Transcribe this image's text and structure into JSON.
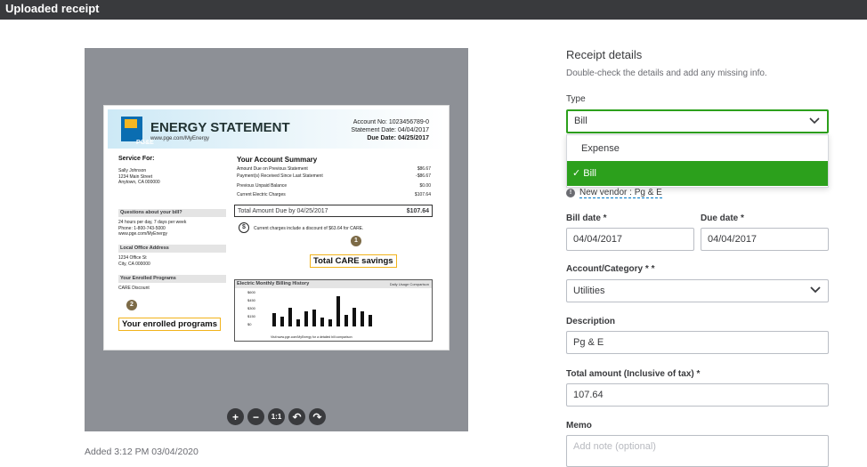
{
  "header": {
    "title": "Uploaded receipt"
  },
  "receipt_image": {
    "title": "ENERGY STATEMENT",
    "url": "www.pge.com/MyEnergy",
    "logo_text": "PG&E",
    "account_no_label": "Account No:",
    "account_no": "1023456789-0",
    "statement_date_label": "Statement Date:",
    "statement_date": "04/04/2017",
    "due_date_label": "Due Date:",
    "due_date": "04/25/2017",
    "service_for": "Service For:",
    "customer_name": "Sally Johnson",
    "customer_street": "1234 Main Street",
    "customer_city": "Anytown, CA 000000",
    "summary_title": "Your Account Summary",
    "summary_rows": [
      {
        "label": "Amount Due on Previous Statement",
        "value": "$86.67"
      },
      {
        "label": "Payment(s) Received Since Last Statement",
        "value": "-$86.67"
      },
      {
        "label": "Previous Unpaid Balance",
        "value": "$0.00"
      },
      {
        "label": "Current Electric Charges",
        "value": "$107.64"
      }
    ],
    "total_label": "Total Amount Due by 04/25/2017",
    "total_value": "$107.64",
    "questions_title": "Questions about your bill?",
    "questions_lines": [
      "24 hours per day, 7 days per week",
      "Phone: 1-800-743-5000",
      "www.pge.com/MyEnergy"
    ],
    "office_title": "Local Office Address",
    "office_lines": [
      "1234 Office St",
      "City, CA 000000"
    ],
    "programs_title": "Your Enrolled Programs",
    "programs_line": "CARE Discount",
    "discount_note": "Current charges include a discount of $63.64 for CARE.",
    "callout_1_num": "1",
    "callout_1": "Total CARE savings",
    "callout_2_num": "2",
    "callout_2": "Your enrolled programs",
    "chart_title": "Electric Monthly Billing History",
    "chart_side": "Daily Usage Comparison",
    "chart_yticks": [
      "$600",
      "$450",
      "$300",
      "$150",
      "$0"
    ],
    "chart_footer": "Visit www.pge.com/MyEnergy for a detailed bill comparison",
    "chart_bars": [
      0.4,
      0.3,
      0.55,
      0.2,
      0.45,
      0.5,
      0.25,
      0.2,
      0.9,
      0.35,
      0.55,
      0.45,
      0.35
    ]
  },
  "toolbar": {
    "zoom_in": "+",
    "zoom_out": "−",
    "actual": "1:1",
    "rotate_left": "↶",
    "rotate_right": "↷"
  },
  "added": "Added 3:12 PM 03/04/2020",
  "details": {
    "title": "Receipt details",
    "subtitle": "Double-check the details and add any missing info.",
    "type_label": "Type",
    "type_value": "Bill",
    "type_options": [
      "Expense",
      "✓ Bill"
    ],
    "vendor": "New vendor : Pg & E",
    "bill_date_label": "Bill date *",
    "bill_date": "04/04/2017",
    "due_date_label": "Due date *",
    "due_date": "04/04/2017",
    "account_label": "Account/Category * *",
    "account_value": "Utilities",
    "description_label": "Description",
    "description_value": "Pg & E",
    "total_label": "Total amount (Inclusive of tax) *",
    "total_value": "107.64",
    "memo_label": "Memo",
    "memo_placeholder": "Add note (optional)"
  },
  "colors": {
    "accent": "#2ca01c",
    "topbar": "#393a3d"
  }
}
